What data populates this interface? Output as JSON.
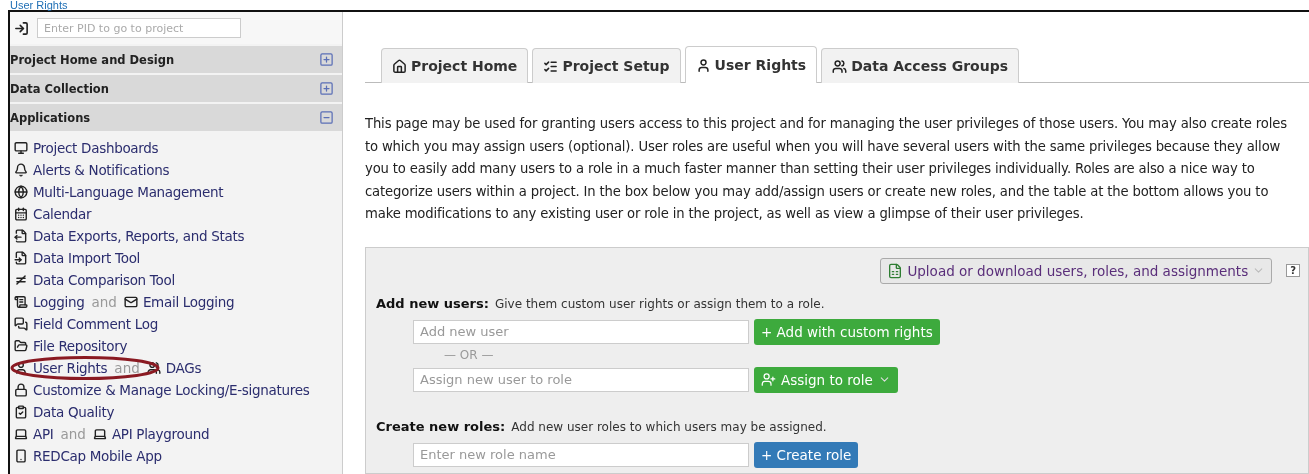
{
  "page_heading": "User Rights",
  "sidebar": {
    "pid_search": {
      "placeholder": "Enter PID to go to project"
    },
    "sections": [
      {
        "title": "Project Home and Design",
        "expanded": false
      },
      {
        "title": "Data Collection",
        "expanded": false
      },
      {
        "title": "Applications",
        "expanded": true
      }
    ],
    "items": [
      {
        "circled": false,
        "parts": [
          {
            "kind": "link",
            "text": "Project Dashboards"
          }
        ]
      },
      {
        "circled": false,
        "parts": [
          {
            "kind": "link",
            "text": "Alerts & Notifications"
          }
        ]
      },
      {
        "circled": false,
        "parts": [
          {
            "kind": "link",
            "text": "Multi-Language Management"
          }
        ]
      },
      {
        "circled": false,
        "parts": [
          {
            "kind": "link",
            "text": "Calendar"
          }
        ]
      },
      {
        "circled": false,
        "parts": [
          {
            "kind": "link",
            "text": "Data Exports, Reports, and Stats"
          }
        ]
      },
      {
        "circled": false,
        "parts": [
          {
            "kind": "link",
            "text": "Data Import Tool"
          }
        ]
      },
      {
        "circled": false,
        "parts": [
          {
            "kind": "link",
            "text": "Data Comparison Tool"
          }
        ]
      },
      {
        "circled": false,
        "parts": [
          {
            "kind": "link",
            "text": "Logging"
          },
          {
            "kind": "joiner",
            "text": "and"
          },
          {
            "kind": "link",
            "text": "Email Logging"
          }
        ]
      },
      {
        "circled": false,
        "parts": [
          {
            "kind": "link",
            "text": "Field Comment Log"
          }
        ]
      },
      {
        "circled": false,
        "parts": [
          {
            "kind": "link",
            "text": "File Repository"
          }
        ]
      },
      {
        "circled": true,
        "parts": [
          {
            "kind": "link",
            "text": "User Rights"
          },
          {
            "kind": "joiner",
            "text": "and"
          },
          {
            "kind": "link",
            "text": "DAGs"
          }
        ]
      },
      {
        "circled": false,
        "parts": [
          {
            "kind": "link",
            "text": "Customize & Manage Locking/E-signatures"
          }
        ]
      },
      {
        "circled": false,
        "parts": [
          {
            "kind": "link",
            "text": "Data Quality"
          }
        ]
      },
      {
        "circled": false,
        "parts": [
          {
            "kind": "link",
            "text": "API"
          },
          {
            "kind": "joiner",
            "text": "and"
          },
          {
            "kind": "link",
            "text": "API Playground"
          }
        ]
      },
      {
        "circled": false,
        "parts": [
          {
            "kind": "link",
            "text": "REDCap Mobile App"
          }
        ]
      }
    ]
  },
  "tabs": [
    {
      "label": "Project Home",
      "selected": false
    },
    {
      "label": "Project Setup",
      "selected": false
    },
    {
      "label": "User Rights",
      "selected": true
    },
    {
      "label": "Data Access Groups",
      "selected": false
    }
  ],
  "intro": "This page may be used for granting users access to this project and for managing the user privileges of those users. You may also create roles to which you may assign users (optional). User roles are useful when you will have several users with the same privileges because they allow you to easily add many users to a role in a much faster manner than setting their user privileges individually. Roles are also a nice way to categorize users within a project. In the box below you may add/assign users or create new roles, and the table at the bottom allows you to make modifications to any existing user or role in the project, as well as view a glimpse of their user privileges.",
  "panel": {
    "upload_button": "Upload or download users, roles, and assignments",
    "help": "?",
    "add_users": {
      "heading": "Add new users:",
      "hint": "Give them custom user rights or assign them to a role.",
      "user_field": {
        "placeholder": "Add new user"
      },
      "custom_button": "+ Add with custom rights",
      "or": "— OR —",
      "role_field": {
        "placeholder": "Assign new user to role"
      },
      "assign_button": "Assign to role"
    },
    "create_roles": {
      "heading": "Create new roles:",
      "hint": "Add new user roles to which users may be assigned.",
      "role_field": {
        "placeholder": "Enter new role name"
      },
      "create_button": "+ Create role"
    }
  }
}
